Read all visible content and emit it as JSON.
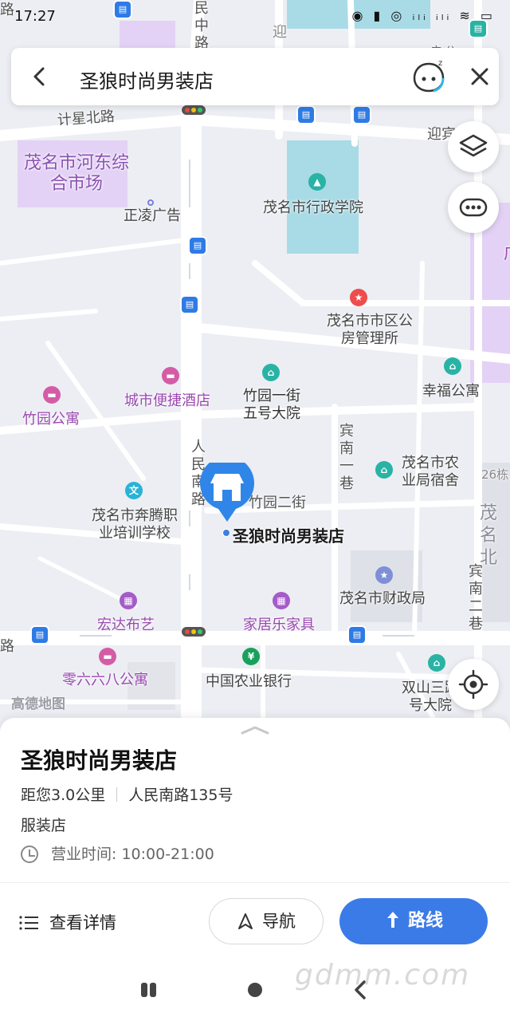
{
  "status_bar": {
    "time": "17:27",
    "icons": "◉ ▮ ◎ ᵢₗᵢ ᵢₗᵢ ≋ ▭"
  },
  "search": {
    "query": "圣狼时尚男装店"
  },
  "map": {
    "watermark": "高德地图",
    "roads": [
      {
        "name": "计星北路"
      },
      {
        "name": "民中路"
      },
      {
        "name": "迎宾"
      },
      {
        "name": "人民南路"
      },
      {
        "name": "竹园二街"
      },
      {
        "name": "宾南一巷"
      },
      {
        "name": "宾南二巷"
      },
      {
        "name": "路"
      },
      {
        "name": "迎"
      },
      {
        "name": "路"
      }
    ],
    "places": [
      {
        "name": "茂名市河东综合市场",
        "icon": "area"
      },
      {
        "name": "正凌广告",
        "icon": "dot"
      },
      {
        "name": "茂名市行政学院",
        "icon": "school-icon"
      },
      {
        "name": "茂名市市区公房管理所",
        "icon": "star-icon"
      },
      {
        "name": "城市便捷酒店",
        "icon": "hotel-icon"
      },
      {
        "name": "竹园公寓",
        "icon": "hotel-icon"
      },
      {
        "name": "竹园一街五号大院",
        "icon": "residence-icon"
      },
      {
        "name": "幸福公寓",
        "icon": "residence-icon"
      },
      {
        "name": "茂名市农业局宿舍",
        "icon": "residence-icon"
      },
      {
        "name": "茂名市奔腾职业培训学校",
        "icon": "education-icon"
      },
      {
        "name": "茂名市财政局",
        "icon": "government-icon"
      },
      {
        "name": "宏达布艺",
        "icon": "shop-icon"
      },
      {
        "name": "家居乐家具",
        "icon": "shop-icon"
      },
      {
        "name": "零六六八公寓",
        "icon": "hotel-icon"
      },
      {
        "name": "中国农业银行",
        "icon": "bank-icon"
      },
      {
        "name": "双山三路号大院",
        "icon": "residence-icon"
      },
      {
        "name": "26栋",
        "icon": "none"
      },
      {
        "name": "茂名北",
        "icon": "none"
      },
      {
        "name": "广",
        "icon": "none"
      },
      {
        "name": "广 公",
        "icon": "none"
      }
    ],
    "selected": {
      "name": "圣狼时尚男装店"
    }
  },
  "sheet": {
    "title": "圣狼时尚男装店",
    "distance": "距您3.0公里",
    "address": "人民南路135号",
    "category": "服装店",
    "hours": "营业时间: 10:00-21:00"
  },
  "actions": {
    "details": "查看详情",
    "navigate": "导航",
    "route": "路线"
  },
  "watermark": "gdmm.com",
  "colors": {
    "accent": "#3b7be8",
    "poi_purple": "#9a48b0",
    "water": "#a8dbe6",
    "area": "#e3d2f5"
  }
}
